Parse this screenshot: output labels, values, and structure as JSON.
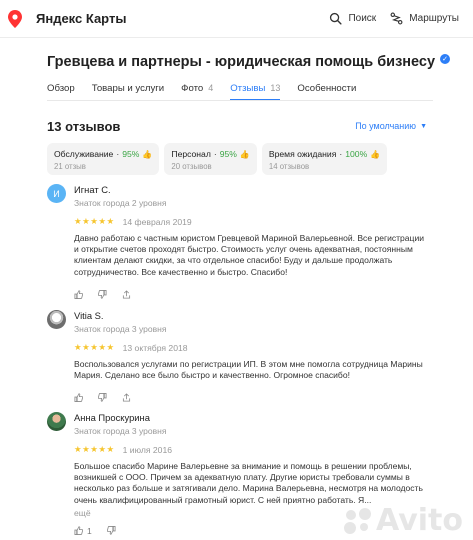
{
  "app": {
    "title": "Яндекс Карты"
  },
  "top_actions": [
    {
      "label": "Поиск",
      "icon": "search-icon"
    },
    {
      "label": "Маршруты",
      "icon": "routes-icon"
    }
  ],
  "organization": {
    "name": "Гревцева и партнеры - юридическая помощь бизнесу",
    "verified_icon": "verified-icon",
    "accent_color": "#2d7ef7"
  },
  "tabs": [
    {
      "label": "Обзор",
      "active": false
    },
    {
      "label": "Товары и услуги",
      "active": false
    },
    {
      "label": "Фото",
      "count": "4",
      "active": false
    },
    {
      "label": "Отзывы",
      "count": "13",
      "active": true
    },
    {
      "label": "Особенности",
      "active": false
    }
  ],
  "reviews_header": {
    "count_label": "13 отзывов",
    "sort_label": "По умолчанию"
  },
  "aspects": [
    {
      "name": "Обслуживание",
      "percent": "95%",
      "sub": "21 отзыв"
    },
    {
      "name": "Персонал",
      "percent": "95%",
      "sub": "20 отзывов"
    },
    {
      "name": "Время ожидания",
      "percent": "100%",
      "sub": "14 отзывов"
    }
  ],
  "reviews": [
    {
      "name": "Игнат С.",
      "initial": "И",
      "level": "Знаток города 2 уровня",
      "rating": 5,
      "stars": "★★★★★",
      "date": "14 февраля 2019",
      "text": "Давно работаю с частным юристом Гревцевой Мариной Валерьевной. Все регистрации и открытие счетов проходят быстро. Стоимость услуг очень адекватная, постоянным клиентам делают скидки, за что отдельное спасибо! Буду и дальше продолжать сотрудничество. Все качественно и быстро. Спасибо!",
      "likes": ""
    },
    {
      "name": "Vitia S.",
      "initial": "",
      "level": "Знаток города 3 уровня",
      "rating": 5,
      "stars": "★★★★★",
      "date": "13 октября 2018",
      "text": "Воспользовался услугами по регистрации ИП. В этом мне помогла сотрудница Марины Мария. Сделано все было быстро и качественно. Огромное спасибо!",
      "likes": ""
    },
    {
      "name": "Анна Проскурина",
      "initial": "",
      "level": "Знаток города 3 уровня",
      "rating": 5,
      "stars": "★★★★★",
      "date": "1 июля 2016",
      "text": "Большое спасибо Марине Валерьевне за внимание и помощь в решении проблемы, возникшей с ООО. Причем за адекватную плату. Другие юристы требовали суммы в несколько раз больше и затягивали дело. Марина Валерьевна, несмотря на молодость очень квалифицированный грамотный юрист. С ней приятно работать. Я...",
      "more": "ещё",
      "likes": "1"
    }
  ],
  "watermark": "Avito"
}
